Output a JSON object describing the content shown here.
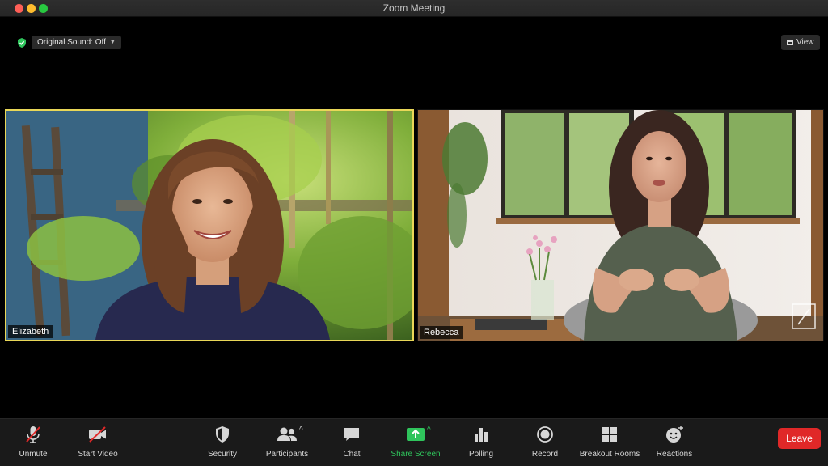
{
  "window": {
    "title": "Zoom Meeting"
  },
  "top_controls": {
    "original_sound": "Original Sound: Off",
    "view": "View"
  },
  "participants": [
    {
      "name": "Elizabeth",
      "active_speaker": true
    },
    {
      "name": "Rebecca",
      "active_speaker": false
    }
  ],
  "toolbar": {
    "unmute": "Unmute",
    "start_video": "Start Video",
    "security": "Security",
    "participants": "Participants",
    "chat": "Chat",
    "share_screen": "Share Screen",
    "polling": "Polling",
    "record": "Record",
    "breakout_rooms": "Breakout Rooms",
    "reactions": "Reactions",
    "leave": "Leave"
  },
  "colors": {
    "active_speaker_border": "#e9d758",
    "share_green": "#2fc45c",
    "leave_red": "#e02828",
    "muted_red": "#e02828"
  }
}
